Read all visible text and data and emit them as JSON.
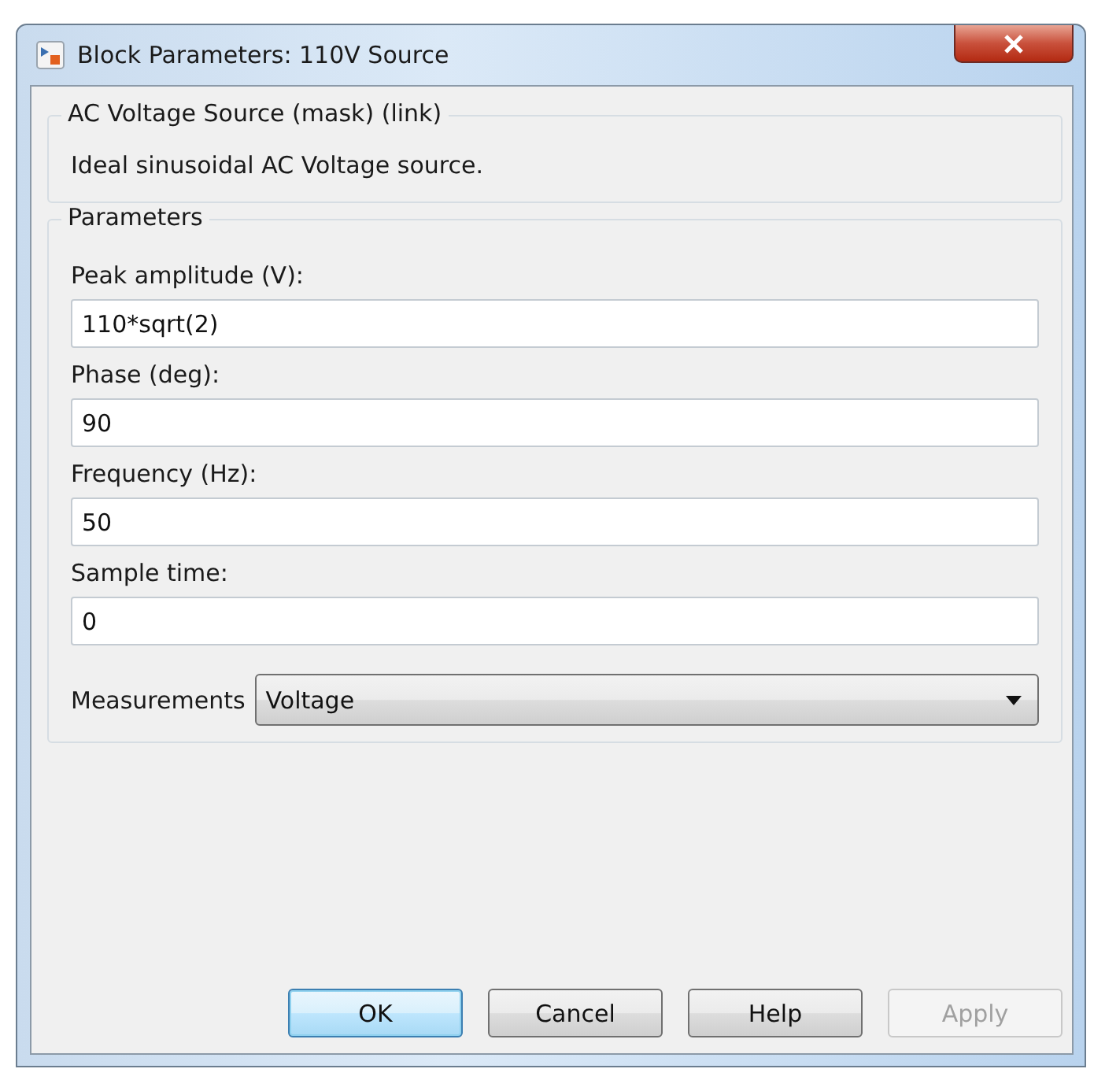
{
  "window": {
    "title": "Block Parameters: 110V Source"
  },
  "description_group": {
    "title": "AC Voltage Source (mask) (link)",
    "text": "Ideal sinusoidal AC Voltage source."
  },
  "parameters": {
    "title": "Parameters",
    "fields": [
      {
        "label": "Peak amplitude (V):",
        "value": "110*sqrt(2)"
      },
      {
        "label": "Phase (deg):",
        "value": "90"
      },
      {
        "label": "Frequency (Hz):",
        "value": "50"
      },
      {
        "label": "Sample time:",
        "value": "0"
      }
    ],
    "measurements": {
      "label": "Measurements",
      "value": "Voltage"
    }
  },
  "buttons": [
    {
      "label": "OK",
      "default": true,
      "disabled": false
    },
    {
      "label": "Cancel",
      "default": false,
      "disabled": false
    },
    {
      "label": "Help",
      "default": false,
      "disabled": false
    },
    {
      "label": "Apply",
      "default": false,
      "disabled": true
    }
  ]
}
